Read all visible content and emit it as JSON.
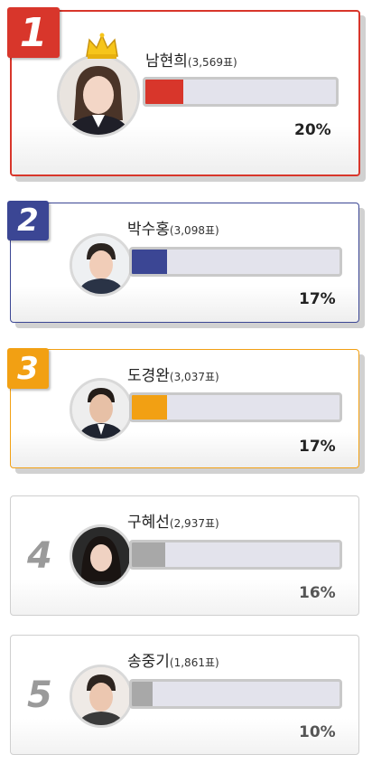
{
  "candidates": [
    {
      "rank": "1",
      "name": "남현희",
      "votes": "(3,569표)",
      "percent": "20%",
      "fill": 0.2,
      "color": "#d8362b",
      "crown_icon": "crown-icon"
    },
    {
      "rank": "2",
      "name": "박수홍",
      "votes": "(3,098표)",
      "percent": "17%",
      "fill": 0.17,
      "color": "#3b4694"
    },
    {
      "rank": "3",
      "name": "도경완",
      "votes": "(3,037표)",
      "percent": "17%",
      "fill": 0.17,
      "color": "#f2a013"
    },
    {
      "rank": "4",
      "name": "구혜선",
      "votes": "(2,937표)",
      "percent": "16%",
      "fill": 0.16,
      "color": "#a8a8a8"
    },
    {
      "rank": "5",
      "name": "송중기",
      "votes": "(1,861표)",
      "percent": "10%",
      "fill": 0.1,
      "color": "#a8a8a8"
    }
  ]
}
